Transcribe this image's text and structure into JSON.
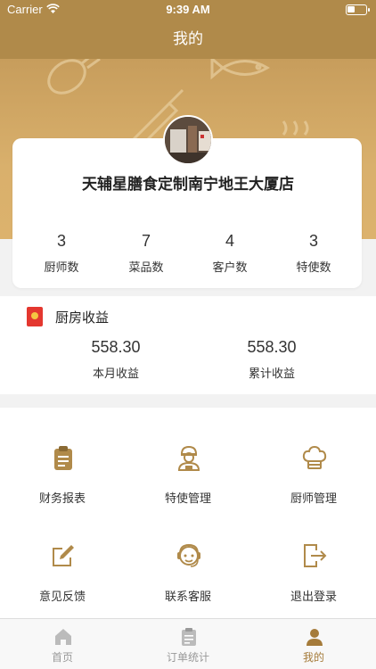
{
  "status_bar": {
    "carrier": "Carrier",
    "time": "9:39 AM"
  },
  "nav": {
    "title": "我的"
  },
  "store": {
    "name": "天辅星膳食定制南宁地王大厦店"
  },
  "stats": [
    {
      "value": "3",
      "label": "厨师数"
    },
    {
      "value": "7",
      "label": "菜品数"
    },
    {
      "value": "4",
      "label": "客户数"
    },
    {
      "value": "3",
      "label": "特使数"
    }
  ],
  "revenue": {
    "title": "厨房收益",
    "items": [
      {
        "value": "558.30",
        "label": "本月收益"
      },
      {
        "value": "558.30",
        "label": "累计收益"
      }
    ]
  },
  "menu": [
    {
      "label": "财务报表",
      "icon": "clipboard-icon"
    },
    {
      "label": "特使管理",
      "icon": "envoy-icon"
    },
    {
      "label": "厨师管理",
      "icon": "chef-hat-icon"
    },
    {
      "label": "意见反馈",
      "icon": "feedback-edit-icon"
    },
    {
      "label": "联系客服",
      "icon": "customer-service-icon"
    },
    {
      "label": "退出登录",
      "icon": "logout-icon"
    }
  ],
  "tabs": [
    {
      "label": "首页",
      "icon": "home-icon"
    },
    {
      "label": "订单统计",
      "icon": "order-stats-icon"
    },
    {
      "label": "我的",
      "icon": "profile-icon"
    }
  ],
  "colors": {
    "brand": "#b08a4a",
    "accent": "#a57b3a",
    "red_packet": "#e4372f"
  }
}
